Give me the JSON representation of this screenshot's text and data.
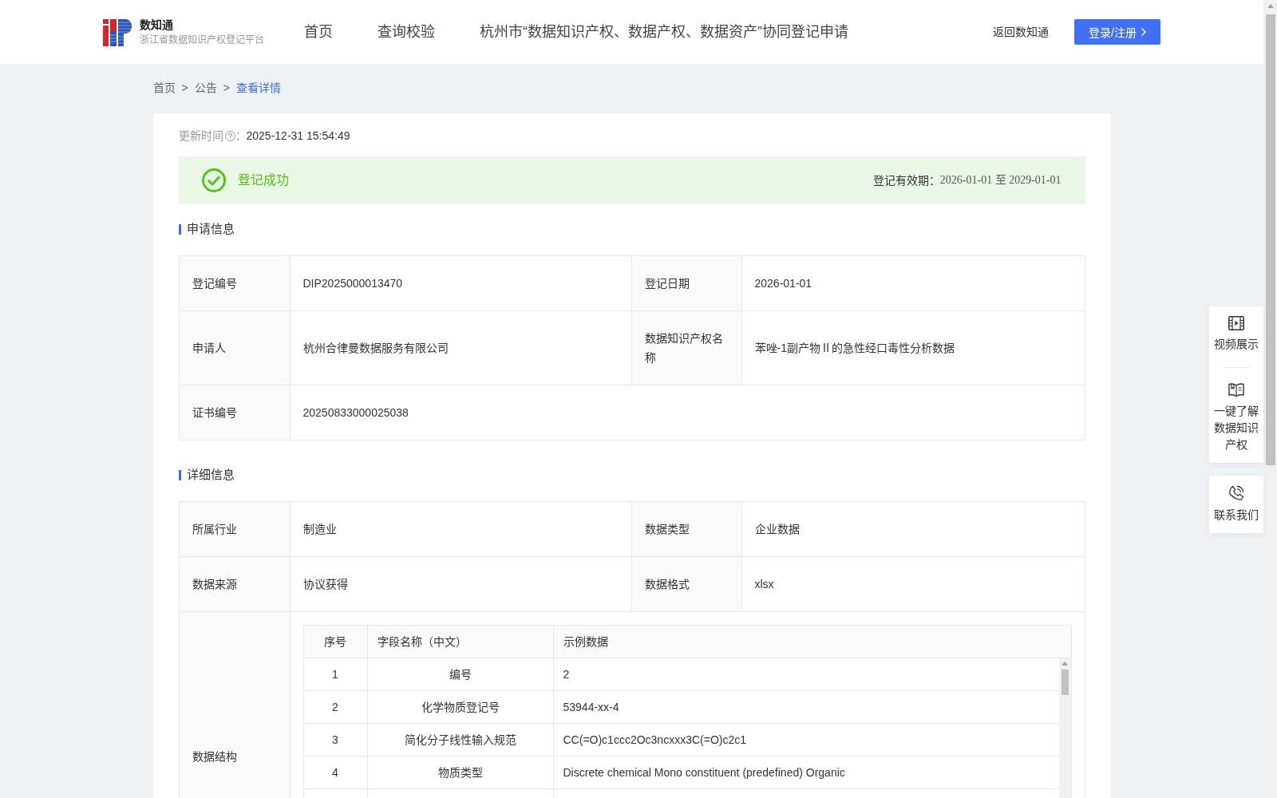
{
  "header": {
    "logo": {
      "title": "数知通",
      "subtitle": "浙江省数据知识产权登记平台"
    },
    "nav": [
      {
        "label": "首页",
        "selected": false
      },
      {
        "label": "查询校验",
        "selected": false
      },
      {
        "label": "杭州市“数据知识产权、数据产权、数据资产”协同登记申请",
        "selected": false
      }
    ],
    "back_link": "返回数知通",
    "login_button": "登录/注册"
  },
  "breadcrumb": {
    "items": [
      {
        "label": "首页",
        "current": false
      },
      {
        "separator": ">",
        "label": "公告",
        "current": false
      },
      {
        "separator": ">",
        "label": "查看详情",
        "current": true
      }
    ]
  },
  "update_time": {
    "label": "更新时间",
    "colon": "：",
    "value": "2025-12-31 15:54:49"
  },
  "status_banner": {
    "success": true,
    "text": "登记成功",
    "validity_label": "登记有效期：",
    "validity_period": "2026-01-01 至 2029-01-01"
  },
  "sections": [
    {
      "title": "申请信息",
      "rows": [
        [
          {
            "kind": "text",
            "label": "登记编号",
            "value": "DIP2025000013470"
          },
          {
            "kind": "text",
            "label": "登记日期",
            "value": "2026-01-01"
          }
        ],
        [
          {
            "kind": "text",
            "label": "申请人",
            "value": "杭州合律曼数据服务有限公司"
          },
          {
            "kind": "text",
            "label": "数据知识产权名称",
            "value": "苯唑-1副产物Ⅱ的急性经口毒性分析数据"
          }
        ],
        [
          {
            "kind": "text",
            "label": "证书编号",
            "value": "20250833000025038"
          }
        ]
      ]
    },
    {
      "title": "详细信息",
      "rows": [
        [
          {
            "kind": "text",
            "label": "所属行业",
            "value": "制造业"
          },
          {
            "kind": "text",
            "label": "数据类型",
            "value": "企业数据"
          }
        ],
        [
          {
            "kind": "text",
            "label": "数据来源",
            "value": "协议获得"
          },
          {
            "kind": "text",
            "label": "数据格式",
            "value": "xlsx"
          }
        ],
        [
          {
            "kind": "table",
            "label": "数据结构",
            "table": {
              "columns": [
                "序号",
                "字段名称（中文）",
                "示例数据"
              ],
              "rows": [
                [
                  "1",
                  "编号",
                  "2"
                ],
                [
                  "2",
                  "化学物质登记号",
                  "53944-xx-4"
                ],
                [
                  "3",
                  "简化分子线性输入规范",
                  "CC(=O)c1ccc2Oc3ncxxx3C(=O)c2c1"
                ],
                [
                  "4",
                  "物质类型",
                  "Discrete chemical Mono constituent (predefined) Organic"
                ]
              ]
            }
          }
        ]
      ]
    }
  ],
  "float_panel": {
    "groups": [
      {
        "items": [
          {
            "kind": "video",
            "label": "视频展示"
          },
          {
            "kind": "book",
            "label": "一键了解数据知识产权"
          }
        ]
      },
      {
        "items": [
          {
            "kind": "phone",
            "label": "联系我们"
          }
        ]
      }
    ]
  }
}
